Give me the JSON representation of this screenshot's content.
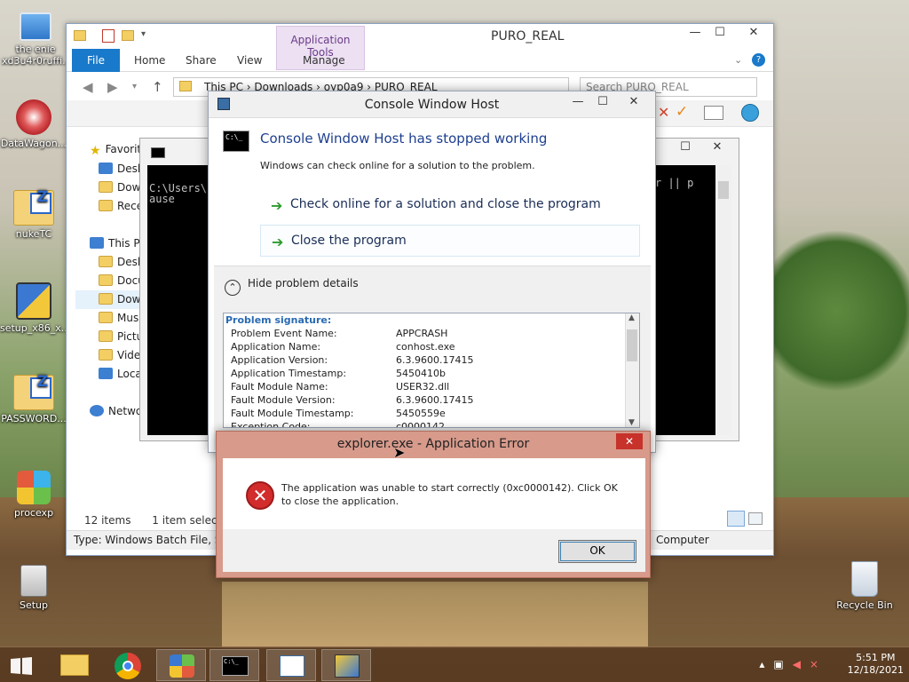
{
  "desktop": {
    "icons": [
      {
        "label": "the enie xd3u4r0ruffi..."
      },
      {
        "label": "DataWagon..."
      },
      {
        "label": "nukeTC"
      },
      {
        "label": "setup_x86_x..."
      },
      {
        "label": "PASSWORD..."
      },
      {
        "label": "procexp"
      },
      {
        "label": "Setup"
      },
      {
        "label": "Recycle Bin"
      }
    ]
  },
  "explorer": {
    "title": "PURO_REAL",
    "context_tab": "Application Tools",
    "tabs": {
      "file": "File",
      "home": "Home",
      "share": "Share",
      "view": "View",
      "manage": "Manage"
    },
    "address": {
      "this_pc": "This PC",
      "downloads": "Downloads",
      "folder": "oyp0a9",
      "current": "PURO_REAL"
    },
    "search_placeholder": "Search PURO_REAL",
    "nav": {
      "favorites": "Favorit",
      "fav_items": [
        "Desk",
        "Dow",
        "Rece"
      ],
      "this_pc": "This P",
      "pc_items": [
        "Desk",
        "Docu",
        "Dow",
        "Mus",
        "Pictu",
        "Vide",
        "Loca"
      ],
      "network": "Netwo"
    },
    "status": {
      "items": "12 items",
      "selected": "1 item selected"
    },
    "details": {
      "type": "Type: Windows Batch File, Size",
      "location": "Computer"
    }
  },
  "console": {
    "line1": "C:\\Users\\",
    "line2": "ause",
    "right_text": "r   || p"
  },
  "cwh": {
    "title": "Console Window Host",
    "heading": "Console Window Host has stopped working",
    "sub": "Windows can check online for a solution to the problem.",
    "option1": "Check online for a solution and close the program",
    "option2": "Close the program",
    "hide_details": "Hide problem details",
    "signature_label": "Problem signature:",
    "details": [
      {
        "k": "Problem Event Name:",
        "v": "APPCRASH"
      },
      {
        "k": "Application Name:",
        "v": "conhost.exe"
      },
      {
        "k": "Application Version:",
        "v": "6.3.9600.17415"
      },
      {
        "k": "Application Timestamp:",
        "v": "5450410b"
      },
      {
        "k": "Fault Module Name:",
        "v": "USER32.dll"
      },
      {
        "k": "Fault Module Version:",
        "v": "6.3.9600.17415"
      },
      {
        "k": "Fault Module Timestamp:",
        "v": "5450559e"
      },
      {
        "k": "Exception Code:",
        "v": "c0000142"
      }
    ]
  },
  "app_error": {
    "title": "explorer.exe - Application Error",
    "message": "The application was unable to start correctly (0xc0000142). Click OK to close the application.",
    "ok": "OK"
  },
  "tray": {
    "time": "5:51 PM",
    "date": "12/18/2021"
  }
}
